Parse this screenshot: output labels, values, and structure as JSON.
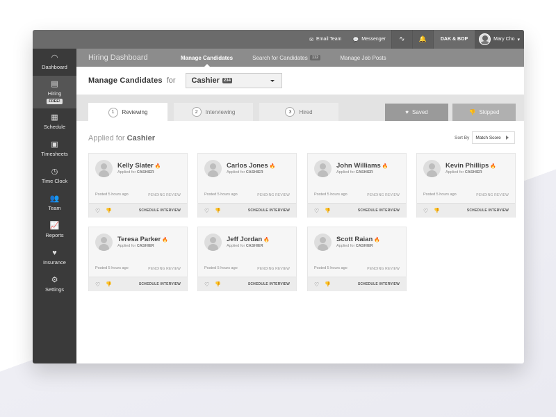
{
  "topbar": {
    "email_team": "Email Team",
    "messenger": "Messenger",
    "org": "DAK & BOP",
    "user_name": "Mary Cho"
  },
  "sidebar": {
    "items": [
      {
        "label": "Dashboard",
        "icon": "gauge-icon"
      },
      {
        "label": "Hiring",
        "icon": "briefcase-icon",
        "badge": "FREE!"
      },
      {
        "label": "Schedule",
        "icon": "calendar-icon"
      },
      {
        "label": "Timesheets",
        "icon": "timesheet-icon"
      },
      {
        "label": "Time Clock",
        "icon": "clock-icon"
      },
      {
        "label": "Team",
        "icon": "team-icon"
      },
      {
        "label": "Reports",
        "icon": "chart-icon"
      },
      {
        "label": "Insurance",
        "icon": "heart-icon"
      },
      {
        "label": "Settings",
        "icon": "gear-icon"
      }
    ]
  },
  "navbar": {
    "title": "Hiring Dashboard",
    "tabs": [
      {
        "label": "Manage Candidates"
      },
      {
        "label": "Search for Candidates",
        "count": "112"
      },
      {
        "label": "Manage Job Posts"
      }
    ]
  },
  "manage": {
    "label": "Manage Candidates",
    "for": "for",
    "position": "Cashier",
    "position_count": "234"
  },
  "status_tabs": [
    {
      "num": "1",
      "label": "Reviewing"
    },
    {
      "num": "2",
      "label": "Interviewing"
    },
    {
      "num": "3",
      "label": "Hired"
    }
  ],
  "actions": {
    "saved": "Saved",
    "skipped": "Skipped"
  },
  "content": {
    "applied_prefix": "Applied for",
    "applied_position": "Cashier",
    "sort_label": "Sort By",
    "sort_value": "Match Score"
  },
  "card_common": {
    "applied_for": "Applied for",
    "position": "CASHIER",
    "posted": "Posted 5 hours ago",
    "status": "PENDING REVIEW",
    "schedule": "SCHEDULE INTERVIEW"
  },
  "candidates": [
    {
      "name": "Kelly Slater"
    },
    {
      "name": "Carlos Jones"
    },
    {
      "name": "John Williams"
    },
    {
      "name": "Kevin Phillips"
    },
    {
      "name": "Teresa Parker"
    },
    {
      "name": "Jeff Jordan"
    },
    {
      "name": "Scott Raian"
    }
  ]
}
